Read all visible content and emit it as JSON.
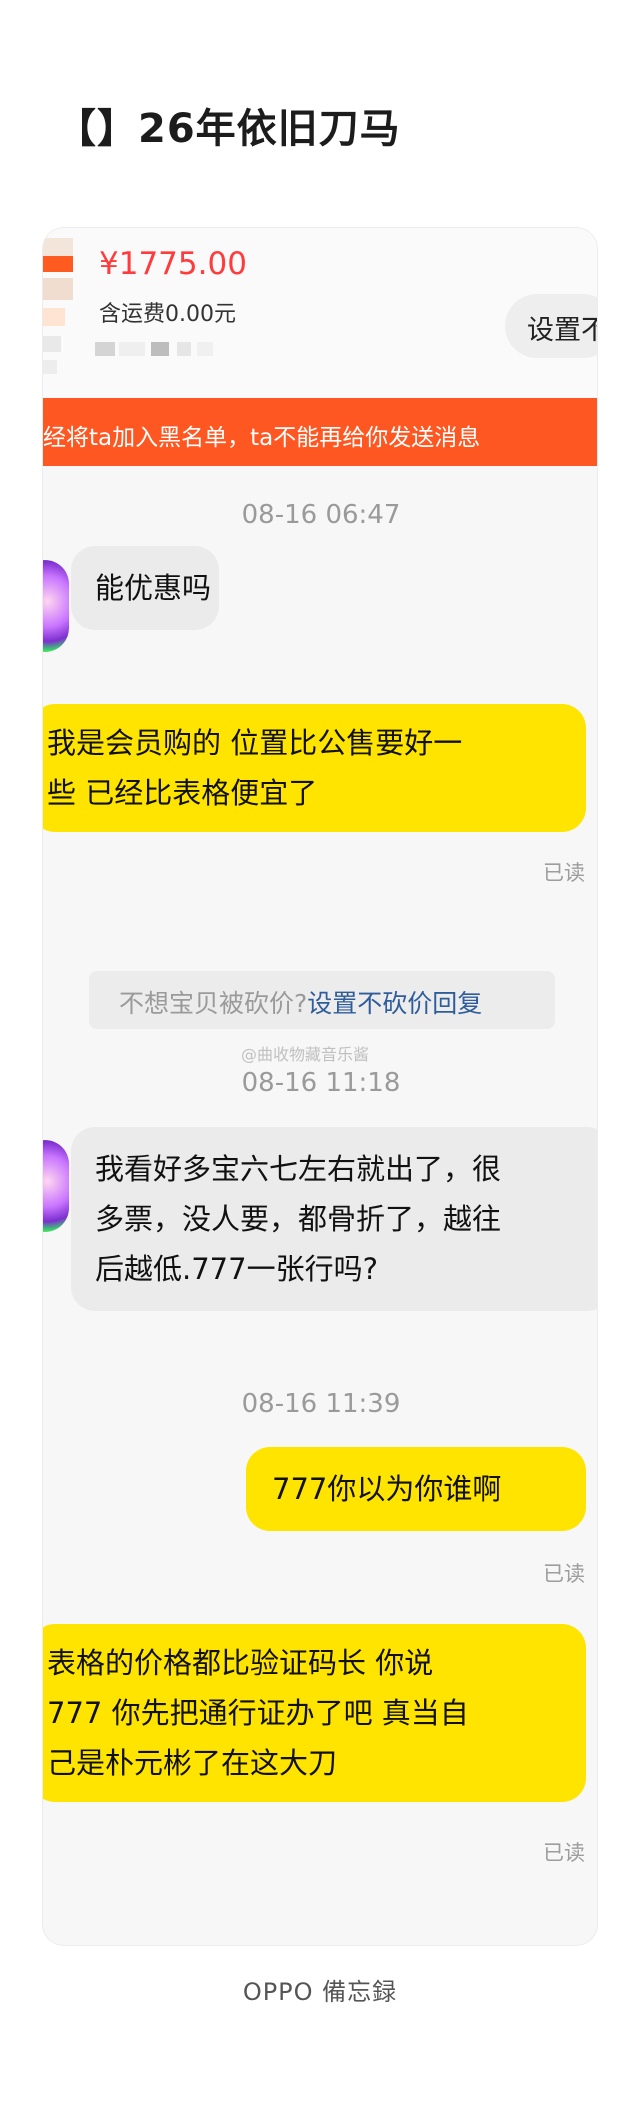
{
  "page": {
    "title": "【】26年依旧刀马",
    "footer": "OPPO 備忘録"
  },
  "product": {
    "price": "¥1775.00",
    "shipping": "含运费0.00元",
    "setting_button": "设置不"
  },
  "banner": {
    "text": "经将ta加入黑名单，ta不能再给你发送消息"
  },
  "tip": {
    "prefix": "不想宝贝被砍价?",
    "link": "设置不砍价回复"
  },
  "watermark": "@曲收物藏音乐酱",
  "messages": [
    {
      "type": "timestamp",
      "text": "08-16 06:47"
    },
    {
      "type": "incoming",
      "text": "能优惠吗"
    },
    {
      "type": "outgoing",
      "lines": [
        "我是会员购的 位置比公售要好一",
        "些 已经比表格便宜了"
      ],
      "status": "已读"
    },
    {
      "type": "timestamp",
      "text": "08-16 11:18"
    },
    {
      "type": "incoming",
      "lines": [
        "我看好多宝六七左右就出了，很",
        "多票，没人要，都骨折了，越往",
        "后越低.777一张行吗?"
      ]
    },
    {
      "type": "timestamp",
      "text": "08-16 11:39"
    },
    {
      "type": "outgoing",
      "text": "777你以为你谁啊",
      "status": "已读"
    },
    {
      "type": "outgoing",
      "lines": [
        "表格的价格都比验证码长 你说",
        "777 你先把通行证办了吧 真当自",
        "己是朴元彬了在这大刀"
      ],
      "status": "已读"
    }
  ],
  "colors": {
    "price": "#ff3b3b",
    "banner": "#ff5722",
    "outgoing_bubble": "#ffe400",
    "incoming_bubble": "#ebebeb",
    "link": "#2f5d9b"
  },
  "icons": {
    "avatar": "user-avatar-icon"
  }
}
